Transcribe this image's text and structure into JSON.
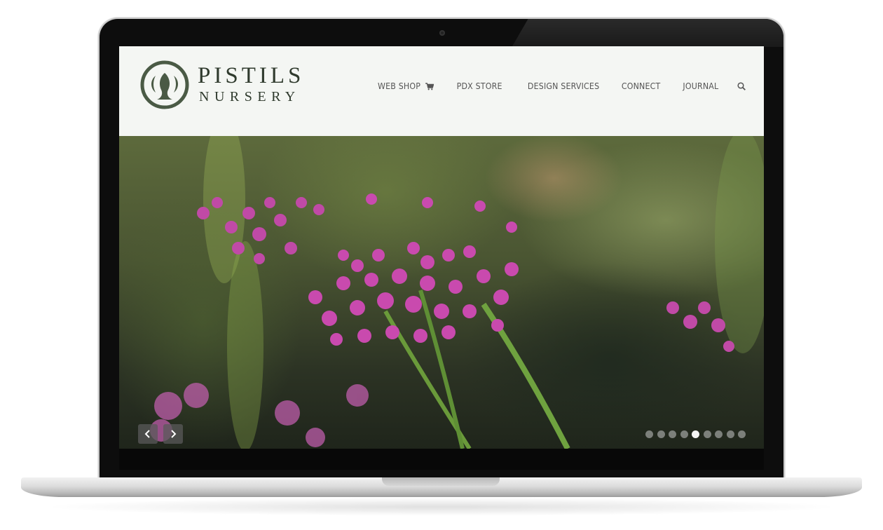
{
  "site": {
    "logo": {
      "line1": "PISTILS",
      "line2": "NURSERY",
      "color": "#4a5a45"
    },
    "nav": [
      {
        "label": "WEB SHOP",
        "icon": "cart-icon"
      },
      {
        "label": "PDX STORE"
      },
      {
        "label": "DESIGN SERVICES"
      },
      {
        "label": "CONNECT"
      },
      {
        "label": "JOURNAL"
      }
    ],
    "search_icon": "search-icon"
  },
  "slider": {
    "prev_icon": "chevron-left-icon",
    "next_icon": "chevron-right-icon",
    "dots_total": 9,
    "active_dot": 5
  },
  "colors": {
    "header_bg": "#f4f6f3",
    "nav_text": "#555555",
    "flower_pink": "#c04aa6"
  }
}
